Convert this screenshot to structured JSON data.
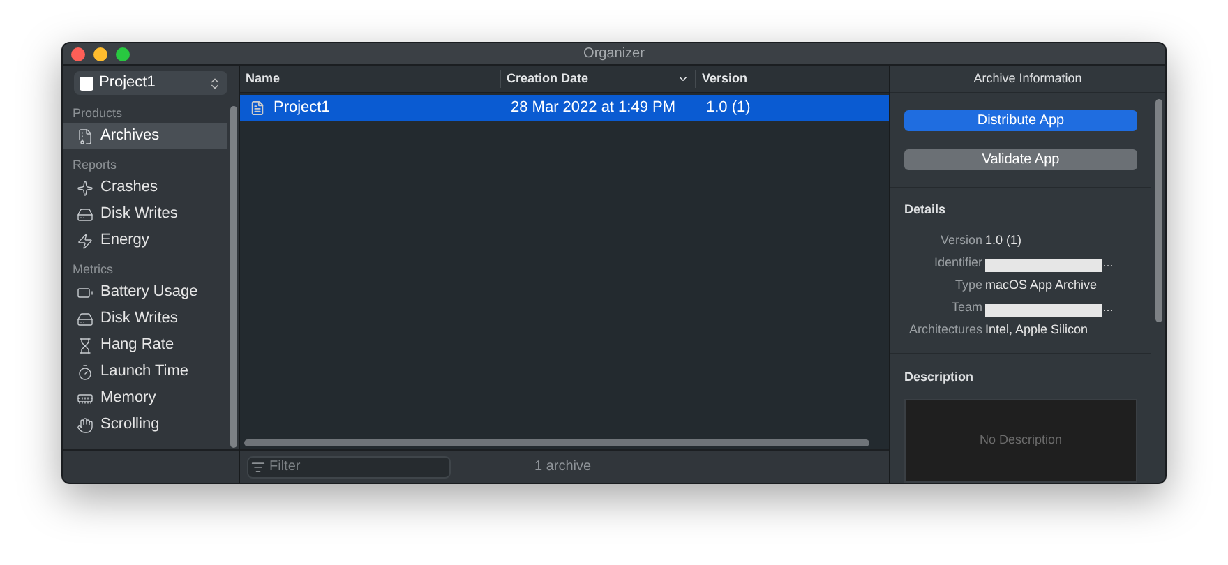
{
  "window": {
    "title": "Organizer"
  },
  "project_picker": {
    "value": "Project1"
  },
  "sidebar": {
    "sections": [
      {
        "title": "Products",
        "items": [
          {
            "label": "Archives",
            "selected": true
          }
        ]
      },
      {
        "title": "Reports",
        "items": [
          {
            "label": "Crashes",
            "selected": false
          },
          {
            "label": "Disk Writes",
            "selected": false
          },
          {
            "label": "Energy",
            "selected": false
          }
        ]
      },
      {
        "title": "Metrics",
        "items": [
          {
            "label": "Battery Usage",
            "selected": false
          },
          {
            "label": "Disk Writes",
            "selected": false
          },
          {
            "label": "Hang Rate",
            "selected": false
          },
          {
            "label": "Launch Time",
            "selected": false
          },
          {
            "label": "Memory",
            "selected": false
          },
          {
            "label": "Scrolling",
            "selected": false
          }
        ]
      }
    ]
  },
  "table": {
    "columns": [
      "Name",
      "Creation Date",
      "Version"
    ],
    "rows": [
      {
        "cells": [
          "Project1",
          "28 Mar 2022 at 1:49 PM",
          "1.0 (1)"
        ],
        "selected": true
      }
    ]
  },
  "filter": {
    "placeholder": "Filter"
  },
  "status": "1 archive",
  "inspector": {
    "title": "Archive Information",
    "buttons": [
      {
        "label": "Distribute App",
        "kind": "primary"
      },
      {
        "label": "Validate App",
        "kind": "secondary"
      }
    ],
    "details_title": "Details",
    "details": [
      {
        "label": "Version",
        "kind": "text",
        "value": "1.0 (1)"
      },
      {
        "label": "Identifier",
        "kind": "redacted",
        "value": "…"
      },
      {
        "label": "Type",
        "kind": "text",
        "value": "macOS App Archive"
      },
      {
        "label": "Team",
        "kind": "redacted",
        "value": "…"
      },
      {
        "label": "Architectures",
        "kind": "text",
        "value": "Intel, Apple Silicon"
      }
    ],
    "description_title": "Description",
    "description_placeholder": "No Description"
  }
}
